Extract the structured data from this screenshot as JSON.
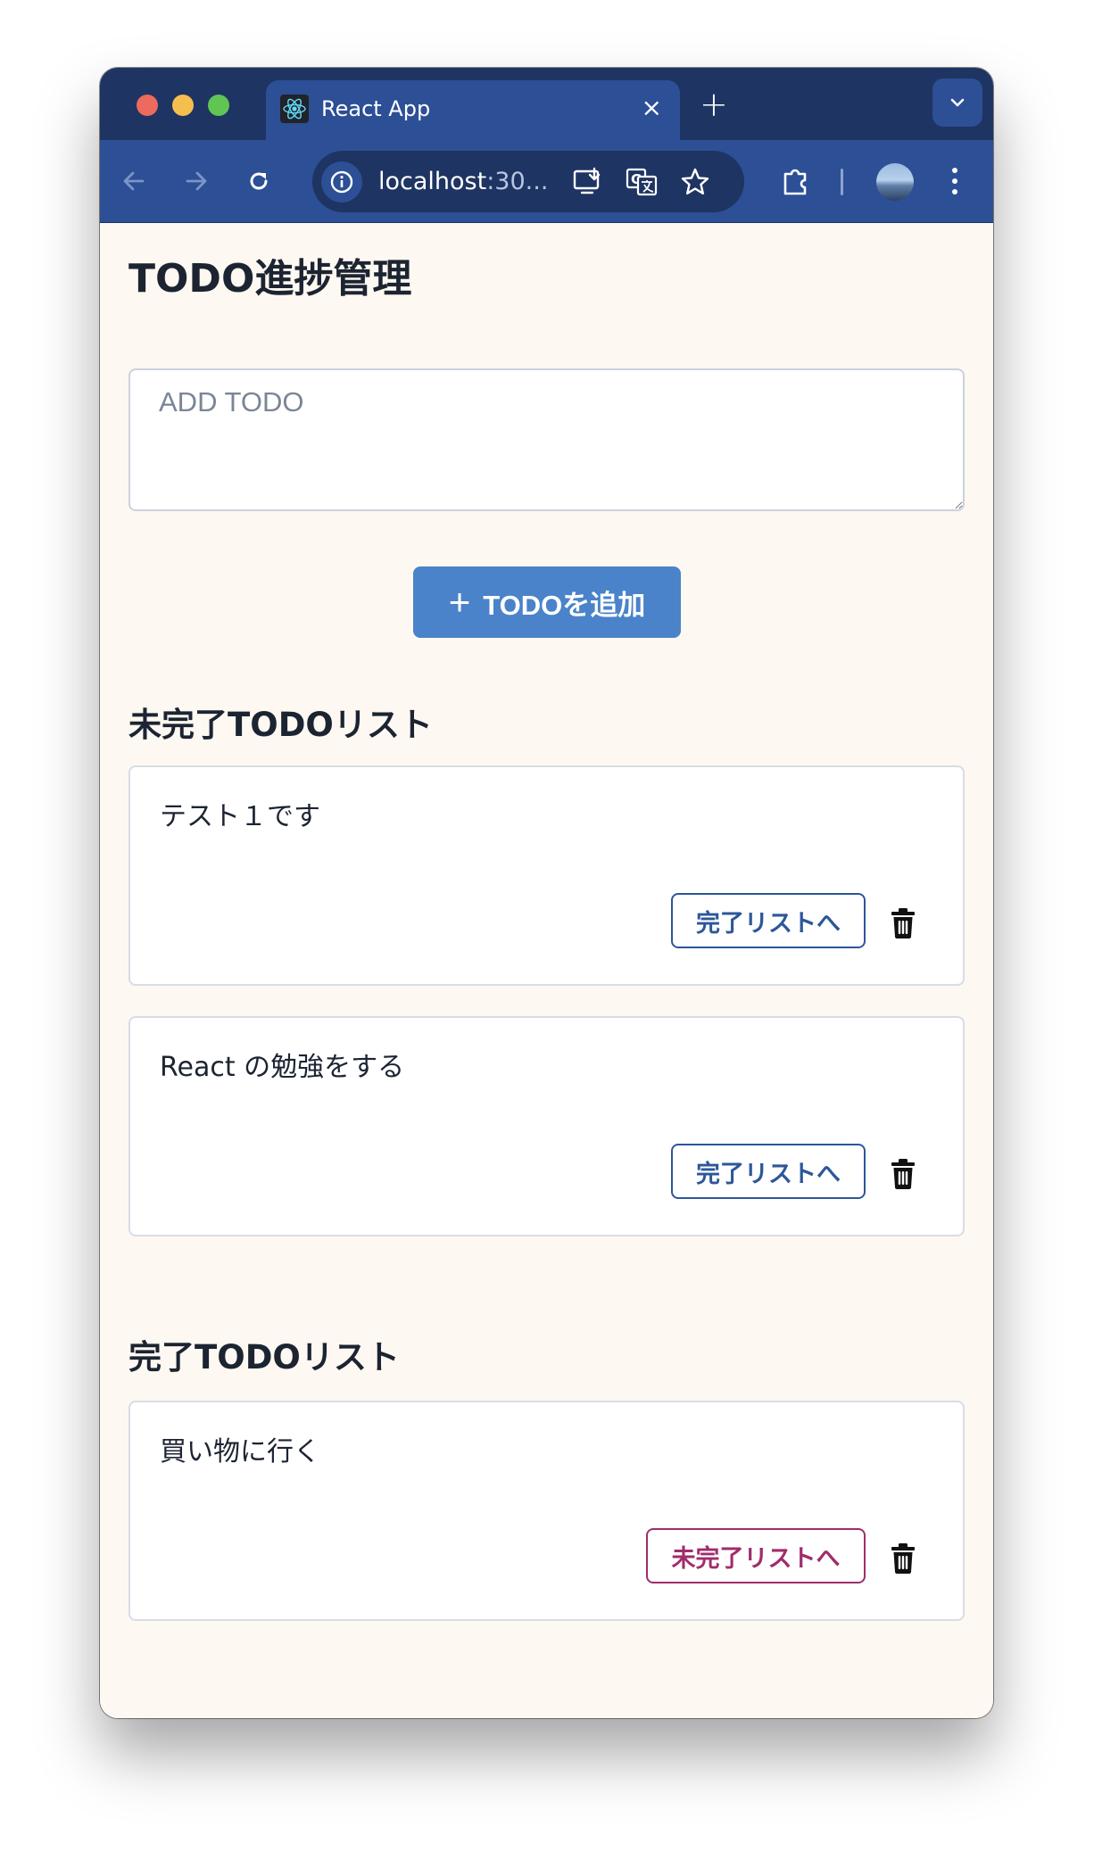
{
  "browser": {
    "tab_title": "React App",
    "tab_close_glyph": "×",
    "new_tab_glyph": "+",
    "url_host": "localhost",
    "url_port_truncated": ":30...",
    "accent": "#2c4f96",
    "titlebar_color": "#1e3462"
  },
  "app": {
    "title": "TODO進捗管理",
    "input_placeholder": "ADD TODO",
    "input_value": "",
    "add_button_icon": "+",
    "add_button_label": "TODOを追加",
    "incomplete_heading": "未完了TODOリスト",
    "complete_heading": "完了TODOリスト",
    "complete_action_label": "完了リストへ",
    "revert_action_label": "未完了リストへ",
    "incomplete_todos": [
      {
        "text": "テスト１です"
      },
      {
        "text": "React の勉強をする"
      }
    ],
    "complete_todos": [
      {
        "text": "買い物に行く"
      }
    ],
    "primary_color": "#4a83c9",
    "complete_button_color": "#2c5799",
    "revert_button_color": "#a12c6c",
    "page_background": "#fdf8f1"
  }
}
